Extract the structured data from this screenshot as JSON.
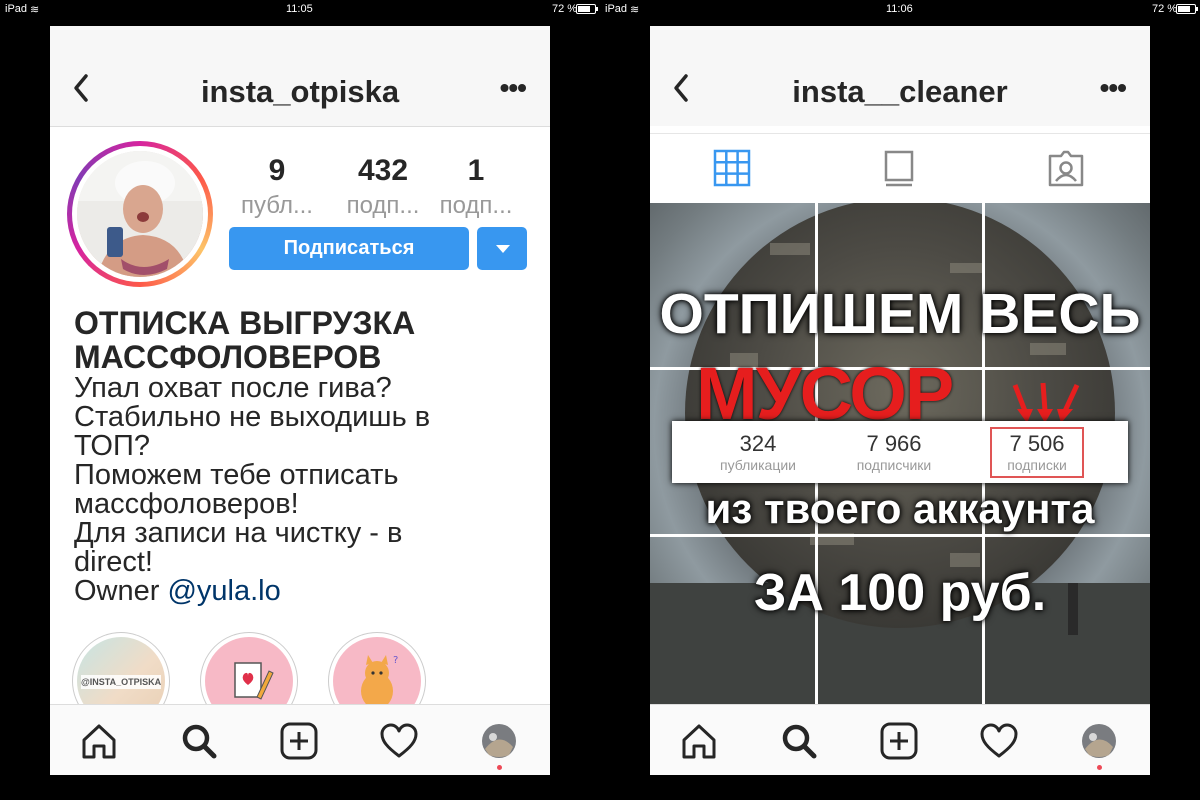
{
  "left": {
    "status": {
      "device": "iPad",
      "time": "11:05",
      "battery": "72 %"
    },
    "header": {
      "username": "insta_otpiska"
    },
    "profile": {
      "stats": [
        {
          "value": "9",
          "label": "публ..."
        },
        {
          "value": "432",
          "label": "подп..."
        },
        {
          "value": "1",
          "label": "подп..."
        }
      ],
      "follow_label": "Подписаться",
      "name_line1": "ОТПИСКА ВЫГРУЗКА",
      "name_line2": "МАССФОЛОВЕРОВ",
      "bio_lines": [
        "Упал охват после гива?",
        "Стабильно не выходишь в",
        "ТОП?",
        "Поможем тебе отписать",
        "массфоловеров!",
        "Для записи на чистку - в",
        "direct!"
      ],
      "owner_prefix": "Owner ",
      "owner_link": "@yula.lo",
      "highlight_caption": "@INSTA_OTPISKA"
    }
  },
  "right": {
    "status": {
      "device": "iPad",
      "time": "11:06",
      "battery": "72 %"
    },
    "header": {
      "username": "insta__cleaner"
    },
    "post": {
      "line1": "ОТПИШЕМ ВЕСЬ",
      "line2": "МУСОР",
      "stats": [
        {
          "value": "324",
          "label": "публикации"
        },
        {
          "value": "7 966",
          "label": "подписчики"
        },
        {
          "value": "7 506",
          "label": "подписки"
        }
      ],
      "line3": "из твоего аккаунта",
      "line4": "ЗА 100 руб."
    }
  },
  "colors": {
    "accent": "#3897f0",
    "notification": "#ed4956",
    "promo_red": "#e61e1e",
    "link": "#003569"
  }
}
